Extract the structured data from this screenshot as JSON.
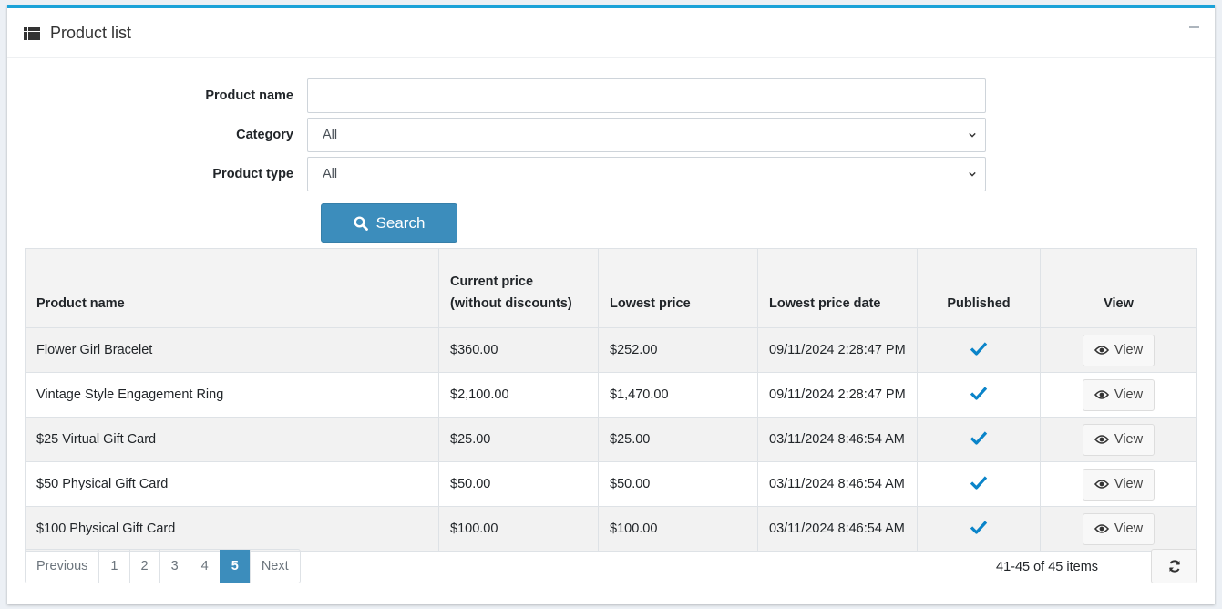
{
  "header": {
    "title": "Product list",
    "icon": "list-icon"
  },
  "filters": {
    "product_name_label": "Product name",
    "product_name_value": "",
    "category_label": "Category",
    "category_value": "All",
    "product_type_label": "Product type",
    "product_type_value": "All",
    "search_label": "Search"
  },
  "table": {
    "columns": {
      "name": "Product name",
      "current_price_line1": "Current price",
      "current_price_line2": "(without discounts)",
      "lowest_price": "Lowest price",
      "lowest_price_date": "Lowest price date",
      "published": "Published",
      "view": "View"
    },
    "rows": [
      {
        "name": "Flower Girl Bracelet",
        "current_price": "$360.00",
        "lowest_price": "$252.00",
        "date": "09/11/2024 2:28:47 PM",
        "published": true,
        "view": "View"
      },
      {
        "name": "Vintage Style Engagement Ring",
        "current_price": "$2,100.00",
        "lowest_price": "$1,470.00",
        "date": "09/11/2024 2:28:47 PM",
        "published": true,
        "view": "View"
      },
      {
        "name": "$25 Virtual Gift Card",
        "current_price": "$25.00",
        "lowest_price": "$25.00",
        "date": "03/11/2024 8:46:54 AM",
        "published": true,
        "view": "View"
      },
      {
        "name": "$50 Physical Gift Card",
        "current_price": "$50.00",
        "lowest_price": "$50.00",
        "date": "03/11/2024 8:46:54 AM",
        "published": true,
        "view": "View"
      },
      {
        "name": "$100 Physical Gift Card",
        "current_price": "$100.00",
        "lowest_price": "$100.00",
        "date": "03/11/2024 8:46:54 AM",
        "published": true,
        "view": "View"
      }
    ]
  },
  "pager": {
    "previous": "Previous",
    "pages": [
      "1",
      "2",
      "3",
      "4",
      "5"
    ],
    "active_page": "5",
    "next": "Next",
    "info": "41-45 of 45 items"
  },
  "colors": {
    "accent": "#3c8dbc",
    "header_border": "#1ba2d8",
    "check": "#0a84c9"
  }
}
